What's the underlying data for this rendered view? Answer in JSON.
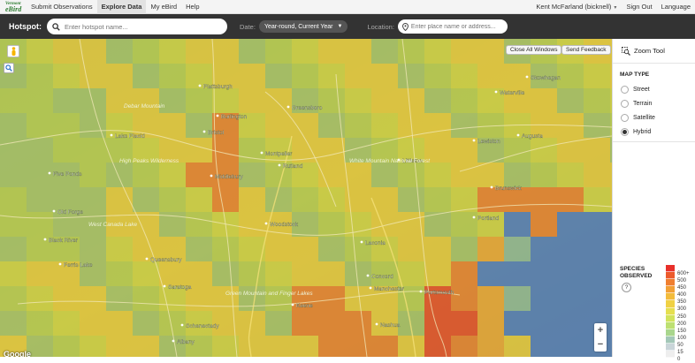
{
  "logo": {
    "line1": "Vermont",
    "line2": "eBird"
  },
  "nav": {
    "items": [
      "Submit Observations",
      "Explore Data",
      "My eBird",
      "Help"
    ],
    "active": "Explore Data",
    "user": "Kent McFarland (bicknell)",
    "sign_out": "Sign Out",
    "language": "Language"
  },
  "search": {
    "hotspot_label": "Hotspot:",
    "hotspot_placeholder": "Enter hotspot name...",
    "date_label": "Date:",
    "date_value": "Year-round, Current Year",
    "location_label": "Location:",
    "location_placeholder": "Enter place name or address..."
  },
  "map": {
    "close_all_label": "Close All Windows",
    "feedback_label": "Send Feedback",
    "attribution": "Google",
    "zoom_in": "+",
    "zoom_out": "−",
    "places": [
      {
        "name": "Plattsburgh"
      },
      {
        "name": "Burlington"
      },
      {
        "name": "Montpelier"
      },
      {
        "name": "Middlebury"
      },
      {
        "name": "Rutland"
      },
      {
        "name": "Woodstock"
      },
      {
        "name": "Bristol"
      },
      {
        "name": "Greensboro"
      },
      {
        "name": "Littleton"
      },
      {
        "name": "Lewiston"
      },
      {
        "name": "Augusta"
      },
      {
        "name": "Brunswick"
      },
      {
        "name": "Portland"
      },
      {
        "name": "Concord"
      },
      {
        "name": "Manchester"
      },
      {
        "name": "Keene"
      },
      {
        "name": "Portsmouth"
      },
      {
        "name": "Laconia"
      },
      {
        "name": "Nashua"
      },
      {
        "name": "Schenectady"
      },
      {
        "name": "Albany"
      },
      {
        "name": "Lake Placid"
      },
      {
        "name": "Five Ponds"
      },
      {
        "name": "Old Forge"
      },
      {
        "name": "Black River"
      },
      {
        "name": "Ferris Lake"
      },
      {
        "name": "Queensbury"
      },
      {
        "name": "Saratoga"
      },
      {
        "name": "Skowhegan"
      },
      {
        "name": "Waterville"
      }
    ],
    "regions": [
      {
        "name": "Debar Mountain"
      },
      {
        "name": "High Peaks Wilderness"
      },
      {
        "name": "West Canada Lake"
      },
      {
        "name": "White Mountain National Forest"
      },
      {
        "name": "Green Mountain and Finger Lakes"
      }
    ]
  },
  "sidebar": {
    "zoom_tool": "Zoom Tool",
    "map_type_title": "MAP TYPE",
    "map_types": [
      "Street",
      "Terrain",
      "Satellite",
      "Hybrid"
    ],
    "selected_map_type": "Hybrid",
    "species_title_1": "SPECIES",
    "species_title_2": "OBSERVED",
    "help": "?",
    "legend": [
      {
        "label": "600+",
        "color": "#e8302a"
      },
      {
        "label": "500",
        "color": "#ec5a2c"
      },
      {
        "label": "450",
        "color": "#f07f30"
      },
      {
        "label": "400",
        "color": "#f2a035"
      },
      {
        "label": "350",
        "color": "#f3bc3c"
      },
      {
        "label": "300",
        "color": "#f0d144"
      },
      {
        "label": "250",
        "color": "#e5df50"
      },
      {
        "label": "200",
        "color": "#d2e35c"
      },
      {
        "label": "150",
        "color": "#bde072"
      },
      {
        "label": "100",
        "color": "#a9d68d"
      },
      {
        "label": "50",
        "color": "#a3c7b8"
      },
      {
        "label": "15",
        "color": "#c9d5d9"
      },
      {
        "label": "0",
        "color": "#eeeeee"
      }
    ]
  }
}
